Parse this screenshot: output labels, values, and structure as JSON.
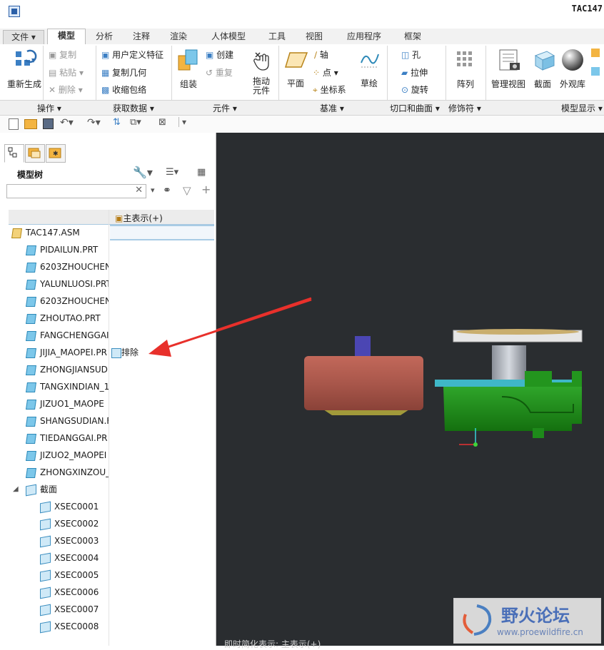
{
  "window": {
    "title": "TAC147"
  },
  "tabs": [
    "文件",
    "模型",
    "分析",
    "注释",
    "渲染",
    "人体模型",
    "工具",
    "视图",
    "应用程序",
    "框架"
  ],
  "ribbon": {
    "regenerate": "重新生成",
    "copy": "复制",
    "paste": "粘贴",
    "delete": "删除",
    "udf": "用户定义特征",
    "copy_geom": "复制几何",
    "shrinkwrap": "收缩包络",
    "assemble": "组装",
    "create": "创建",
    "repeat": "重复",
    "drag": "拖动\n元件",
    "plane": "平面",
    "axis": "轴",
    "point": "点",
    "csys": "坐标系",
    "sketch": "草绘",
    "hole": "孔",
    "extrude": "拉伸",
    "revolve": "旋转",
    "pattern": "阵列",
    "manage_views": "管理视图",
    "section": "截面",
    "appearance": "外观库"
  },
  "groups": [
    "操作",
    "获取数据",
    "元件",
    "基准",
    "切口和曲面",
    "修饰符",
    "模型显示"
  ],
  "model_tree": {
    "title": "模型树",
    "column_header": "主表示(+)",
    "search_value": "",
    "root": "TAC147.ASM",
    "parts": [
      "PIDAILUN.PRT",
      "6203ZHOUCHEN",
      "YALUNLUOSI.PRT",
      "6203ZHOUCHEN",
      "ZHOUTAO.PRT",
      "FANGCHENGGAI",
      "JIJIA_MAOPEI.PR",
      "ZHONGJIANSUD",
      "TANGXINDIAN_1",
      "JIZUO1_MAOPE",
      "SHANGSUDIAN.F",
      "TIEDANGGAI.PR",
      "JIZUO2_MAOPEI",
      "ZHONGXINZOU_"
    ],
    "exclude_label": "排除",
    "sections_folder": "截面",
    "sections": [
      "XSEC0001",
      "XSEC0002",
      "XSEC0003",
      "XSEC0004",
      "XSEC0005",
      "XSEC0006",
      "XSEC0007",
      "XSEC0008"
    ]
  },
  "status_text": "即时简化表示: 主表示(+)",
  "watermark": {
    "title": "野火论坛",
    "url": "www.proewildfire.cn"
  },
  "colors": {
    "viewport_bg": "#2a2d30",
    "annotation_arrow": "#e8302b"
  }
}
